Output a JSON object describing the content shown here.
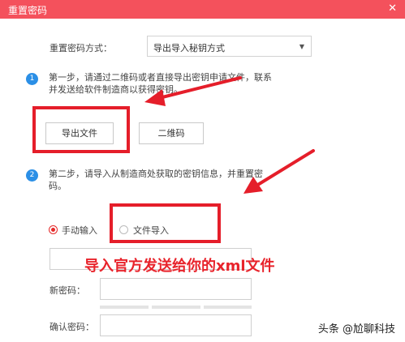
{
  "window": {
    "title": "重置密码",
    "close_glyph": "✕"
  },
  "form": {
    "method_label": "重置密码方式：",
    "method_select": {
      "value": "导出导入秘钥方式",
      "caret": "▼"
    }
  },
  "step1": {
    "number": "1",
    "line1": "第一步，请通过二维码或者直接导出密钥申请文件，联系",
    "line2": "并发送给软件制造商以获得密钥。",
    "export_button": "导出文件",
    "qr_button": "二维码"
  },
  "step2": {
    "number": "2",
    "line1": "第二步，请导入从制造商处获取的密钥信息，并重置密",
    "line2": "码。",
    "manual_input_label": "手动输入",
    "file_import_label": "文件导入"
  },
  "annotation_text": "导入官方发送给你的xml文件",
  "new_password_label": "新密码：",
  "confirm_password_label": "确认密码：",
  "watermark": "头条 @尬聊科技",
  "colors": {
    "titlebar": "#f4515c",
    "annotation": "#e51e2a",
    "step_badge": "#2b8fe6"
  },
  "icons": [
    "close-icon",
    "chevron-down-icon",
    "arrow-icon"
  ]
}
